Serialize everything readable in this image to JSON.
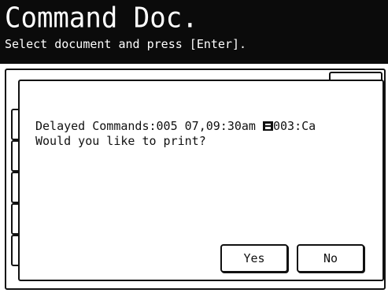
{
  "header": {
    "title": "Command Doc.",
    "subtitle": "Select document and press [Enter]."
  },
  "dialog": {
    "line1_prefix": "Delayed Commands:005 07,09:30am ",
    "line1_icon": "fax-document-icon",
    "line1_suffix": "003:Ca",
    "line2": "Would you like to print?",
    "yes_label": "Yes",
    "no_label": "No"
  },
  "colors": {
    "header_bg": "#0b0b0b",
    "header_text": "#ffffff",
    "border": "#111111"
  }
}
